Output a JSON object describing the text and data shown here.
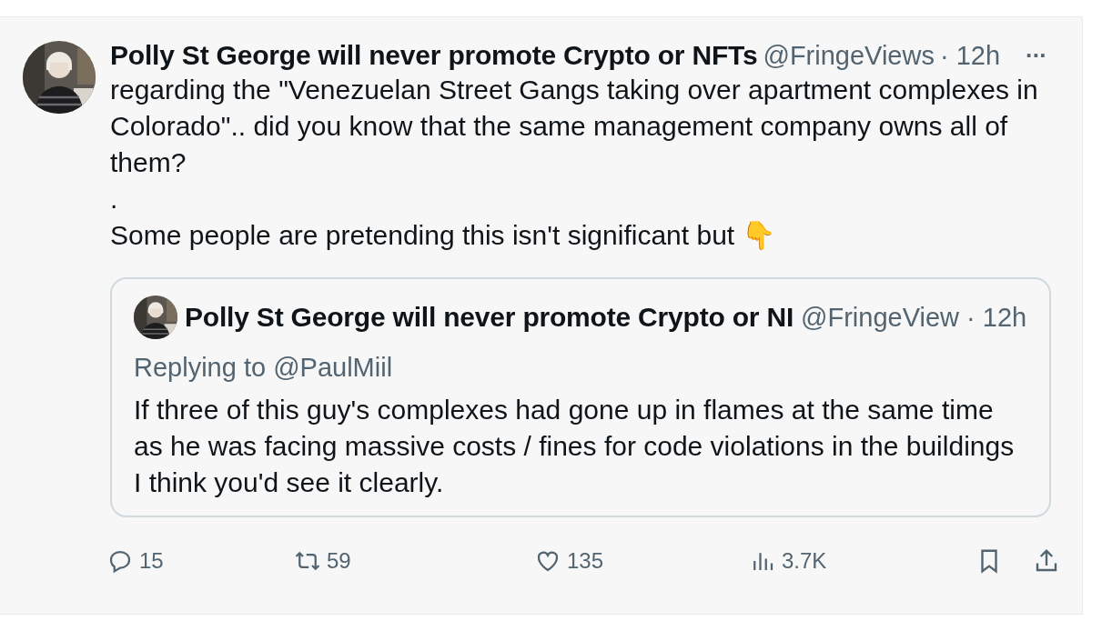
{
  "post": {
    "author": {
      "name": "Polly St George will never promote Crypto or NFTs",
      "handle": "@FringeViews",
      "time": "· 12h"
    },
    "more": "···",
    "paragraphs": [
      "regarding the \"Venezuelan Street Gangs taking over apartment complexes in Colorado\".. did you know that the same management company owns all of them?",
      ".",
      "Some people are pretending this isn't significant but 👇"
    ],
    "quote": {
      "author": {
        "name": "Polly St George will never promote Crypto or NI",
        "handle": "@FringeView",
        "time": "· 12h"
      },
      "replying_to": "Replying to @PaulMiil",
      "text": "If three of this guy's complexes had gone up in flames at the same time as he was facing massive costs / fines for code violations in the buildings I think you'd see it clearly."
    },
    "actions": [
      {
        "kind": "reply",
        "count": "15"
      },
      {
        "kind": "repost",
        "count": "59"
      },
      {
        "kind": "like",
        "count": "135"
      },
      {
        "kind": "views",
        "count": "3.7K"
      },
      {
        "kind": "bookmark"
      },
      {
        "kind": "share"
      }
    ]
  }
}
